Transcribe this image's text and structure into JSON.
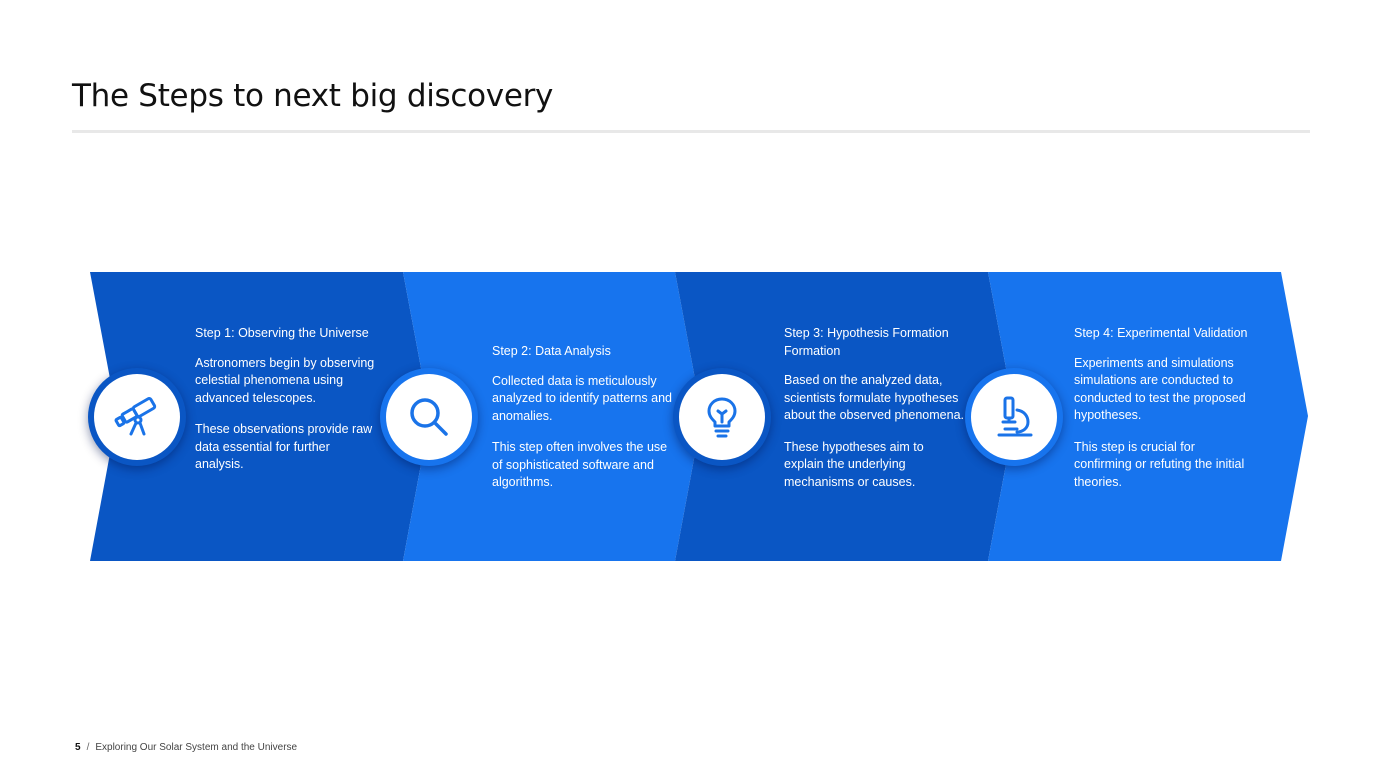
{
  "slide": {
    "title": "The Steps to next big discovery",
    "footer": {
      "page_number": "5",
      "separator": "/",
      "deck_title": "Exploring Our Solar System and the Universe"
    }
  },
  "colors": {
    "dark_blue": "#0A56C4",
    "bright_blue": "#1774EE",
    "icon_blue": "#1A73E8",
    "white": "#FFFFFF"
  },
  "steps": [
    {
      "icon": "telescope-icon",
      "heading": "Step 1: Observing the Universe",
      "paragraphs": [
        "Astronomers begin by observing celestial phenomena using advanced telescopes.",
        "These observations provide raw data essential for further analysis."
      ]
    },
    {
      "icon": "magnifier-icon",
      "heading": "Step 2: Data Analysis",
      "paragraphs": [
        "Collected data is meticulously analyzed to identify patterns and anomalies.",
        "This step often involves the use of sophisticated software and algorithms."
      ]
    },
    {
      "icon": "lightbulb-icon",
      "heading": "Step 3: Hypothesis Formation Formation",
      "paragraphs": [
        "Based on the analyzed data, scientists formulate hypotheses about the observed phenomena.",
        "These hypotheses aim to explain the underlying mechanisms or causes."
      ]
    },
    {
      "icon": "microscope-icon",
      "heading": "Step 4: Experimental Validation",
      "paragraphs": [
        "Experiments and simulations simulations are conducted to conducted to test the proposed hypotheses.",
        "This step is crucial for confirming or refuting the initial theories."
      ]
    }
  ]
}
